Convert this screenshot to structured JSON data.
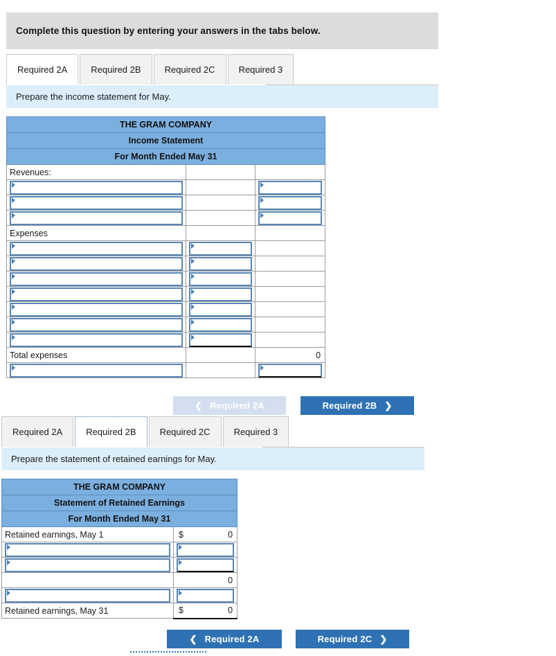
{
  "banner": {
    "text": "Complete this question by entering your answers in the tabs below."
  },
  "section_a": {
    "tabs": [
      {
        "label": "Required 2A",
        "active": true
      },
      {
        "label": "Required 2B",
        "active": false
      },
      {
        "label": "Required 2C",
        "active": false
      },
      {
        "label": "Required 3",
        "active": false
      }
    ],
    "prompt": "Prepare the income statement for May.",
    "table": {
      "title_lines": [
        "THE GRAM COMPANY",
        "Income Statement",
        "For Month Ended May 31"
      ],
      "rows": [
        {
          "label": "Revenues:",
          "type": "label"
        },
        {
          "label": "",
          "type": "input_label_right"
        },
        {
          "label": "",
          "type": "input_label_right"
        },
        {
          "label": "",
          "type": "input_label_right"
        },
        {
          "label": "Expenses",
          "type": "label"
        },
        {
          "label": "",
          "type": "input_label_mid"
        },
        {
          "label": "",
          "type": "input_label_mid"
        },
        {
          "label": "",
          "type": "input_label_mid"
        },
        {
          "label": "",
          "type": "input_label_mid"
        },
        {
          "label": "",
          "type": "input_label_mid"
        },
        {
          "label": "",
          "type": "input_label_mid"
        },
        {
          "label": "",
          "type": "input_label_mid"
        },
        {
          "label": "Total expenses",
          "type": "total",
          "value": "0"
        },
        {
          "label": "",
          "type": "input_label_right_final"
        }
      ]
    },
    "nav": {
      "prev_label": "Required 2A",
      "prev_disabled": true,
      "next_label": "Required 2B",
      "next_disabled": false,
      "prev_icon": "chevron-left-icon",
      "next_icon": "chevron-right-icon"
    }
  },
  "section_b": {
    "tabs": [
      {
        "label": "Required 2A",
        "active": false
      },
      {
        "label": "Required 2B",
        "active": true
      },
      {
        "label": "Required 2C",
        "active": false
      },
      {
        "label": "Required 3",
        "active": false
      }
    ],
    "prompt": "Prepare the statement of retained earnings for May.",
    "table": {
      "title_lines": [
        "THE GRAM COMPANY",
        "Statement of Retained Earnings",
        "For Month Ended May 31"
      ],
      "rows": [
        {
          "label": "Retained earnings, May 1",
          "type": "value",
          "currency": "$",
          "value": "0"
        },
        {
          "label": "",
          "type": "input_row"
        },
        {
          "label": "",
          "type": "input_row"
        },
        {
          "label": "",
          "type": "subtotal",
          "value": "0"
        },
        {
          "label": "",
          "type": "input_row"
        },
        {
          "label": "Retained earnings, May 31",
          "type": "value_final",
          "currency": "$",
          "value": "0"
        }
      ]
    },
    "nav": {
      "prev_label": "Required 2A",
      "prev_disabled": false,
      "next_label": "Required 2C",
      "next_disabled": false,
      "prev_icon": "chevron-left-icon",
      "next_icon": "chevron-right-icon"
    }
  },
  "colors": {
    "header_blue": "#7bafdf",
    "prompt_blue": "#ddeefb",
    "banner_grey": "#dcdcdc",
    "button_blue": "#2f72b4",
    "button_disabled": "#d3dfef",
    "input_border": "#5786b5"
  }
}
